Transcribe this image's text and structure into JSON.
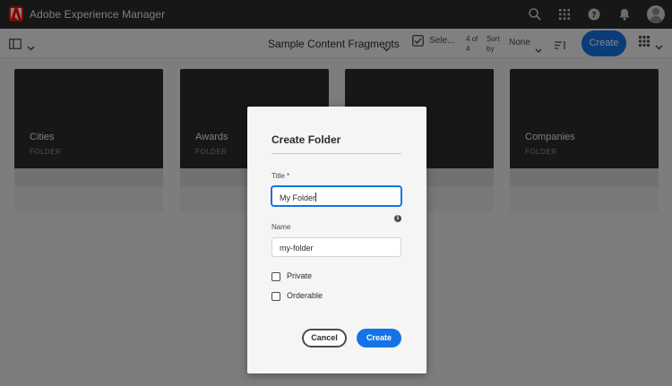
{
  "app": {
    "title": "Adobe Experience Manager"
  },
  "topbar": {
    "icons": [
      "search-icon",
      "apps-grid-icon",
      "help-icon",
      "notifications-bell-icon",
      "user-avatar"
    ]
  },
  "actionbar": {
    "collection_title": "Sample Content Fragments",
    "select_label": "Sele...",
    "count_line1": "4 of",
    "count_line2": "4",
    "sort_line1": "Sort",
    "sort_line2": "by",
    "sort_value": "None",
    "create_label": "Create",
    "icons": [
      "rail-toggle-icon",
      "chevron-down-icon",
      "select-checkbox-icon",
      "sort-order-icon",
      "view-switcher-icon"
    ]
  },
  "cards": [
    {
      "name": "Cities",
      "type": "FOLDER"
    },
    {
      "name": "Awards",
      "type": "FOLDER"
    },
    {
      "name": "",
      "type": ""
    },
    {
      "name": "Companies",
      "type": "FOLDER"
    }
  ],
  "dialog": {
    "title": "Create Folder",
    "title_field_label": "Title *",
    "title_field_value": "My Folder",
    "name_field_label": "Name",
    "name_field_value": "my-folder",
    "private_label": "Private",
    "orderable_label": "Orderable",
    "cancel_label": "Cancel",
    "create_label": "Create"
  },
  "colors": {
    "accent": "#1473e6",
    "brand": "#fa0f00",
    "shell": "#2c2c2c"
  }
}
